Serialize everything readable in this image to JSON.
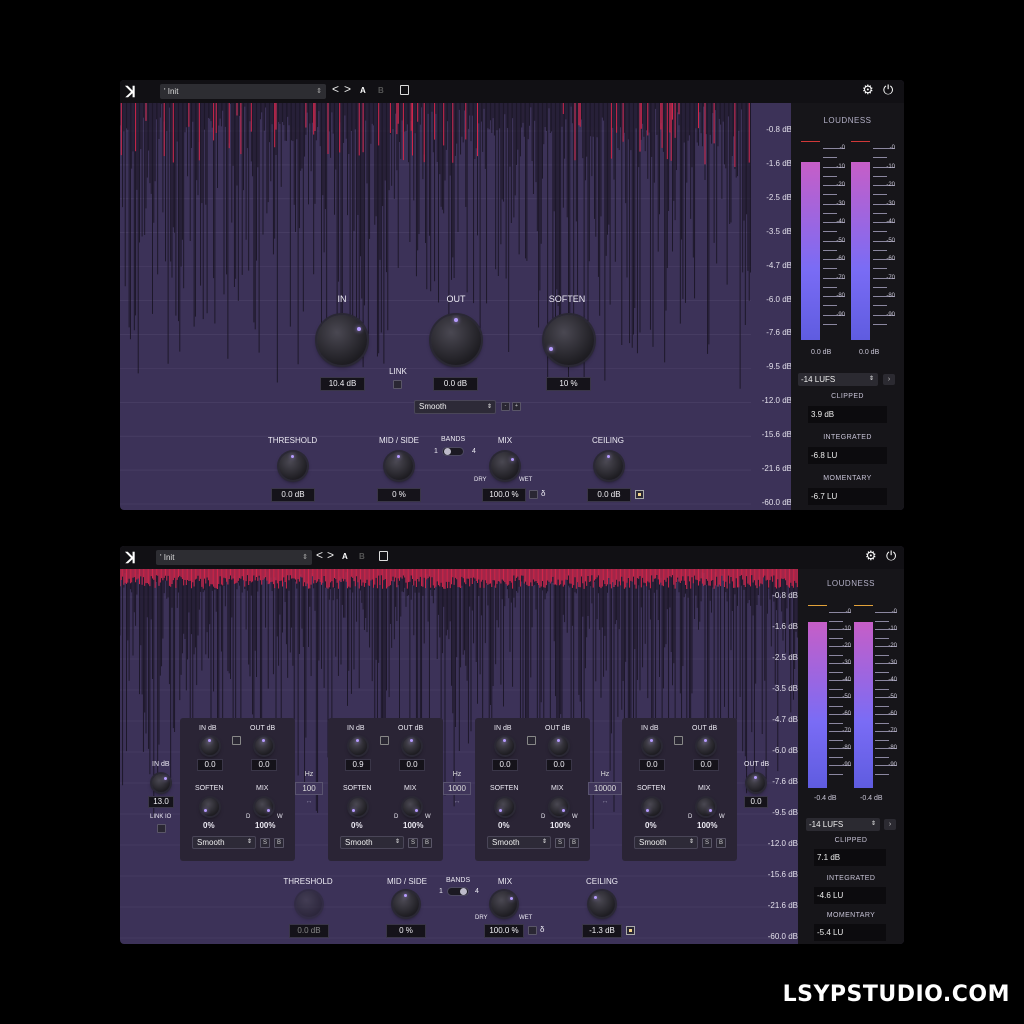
{
  "window": {
    "preset_name": "' Init",
    "nav_prev": "<",
    "nav_next": ">",
    "a_label": "A",
    "b_label": "B"
  },
  "db_scale": [
    "-0.8 dB",
    "-1.6 dB",
    "-2.5 dB",
    "-3.5 dB",
    "-4.7 dB",
    "-6.0 dB",
    "-7.6 dB",
    "-9.5 dB",
    "-12.0 dB",
    "-15.6 dB",
    "-21.6 dB",
    "-60.0 dB"
  ],
  "meter_scale": [
    "-0",
    "-10",
    "-20",
    "-30",
    "-40",
    "-50",
    "-60",
    "-70",
    "-80",
    "-90"
  ],
  "loudness": {
    "title": "LOUDNESS",
    "target": "-14 LUFS",
    "clipped_label": "CLIPPED",
    "integrated_label": "INTEGRATED",
    "momentary_label": "MOMENTARY"
  },
  "top": {
    "knobs": {
      "in_label": "IN",
      "out_label": "OUT",
      "soften_label": "SOFTEN",
      "in_value": "10.4 dB",
      "out_value": "0.0 dB",
      "soften_value": "10 %"
    },
    "link_label": "LINK",
    "mode": "Smooth",
    "threshold_label": "THRESHOLD",
    "threshold_value": "0.0 dB",
    "midside_label": "MID / SIDE",
    "midside_value": "0 %",
    "bands_label": "BANDS",
    "bands_min": "1",
    "bands_max": "4",
    "mix_label": "MIX",
    "mix_dry": "DRY",
    "mix_wet": "WET",
    "mix_value": "100.0 %",
    "delta": "δ",
    "ceiling_label": "CEILING",
    "ceiling_value": "0.0 dB",
    "meter_left": "0.0 dB",
    "meter_right": "0.0 dB",
    "clipped": "3.9 dB",
    "integrated": "-6.8 LU",
    "momentary": "-6.7 LU"
  },
  "bottom": {
    "in_db_label": "IN dB",
    "in_db_value": "13.0",
    "link_io": "LINK IO",
    "out_db_label": "OUT dB",
    "out_db_value": "0.0",
    "hz_label": "Hz",
    "crossovers": [
      "100",
      "1000",
      "10000"
    ],
    "bands": [
      {
        "in_label": "IN dB",
        "out_label": "OUT dB",
        "in": "0.0",
        "out": "0.0",
        "soften_label": "SOFTEN",
        "mix_label": "MIX",
        "soften": "0%",
        "mix": "100%",
        "mode": "Smooth",
        "s": "S",
        "b": "B",
        "d": "D",
        "w": "W"
      },
      {
        "in_label": "IN dB",
        "out_label": "OUT dB",
        "in": "0.9",
        "out": "0.0",
        "soften_label": "SOFTEN",
        "mix_label": "MIX",
        "soften": "0%",
        "mix": "100%",
        "mode": "Smooth",
        "s": "S",
        "b": "B",
        "d": "D",
        "w": "W"
      },
      {
        "in_label": "IN dB",
        "out_label": "OUT dB",
        "in": "0.0",
        "out": "0.0",
        "soften_label": "SOFTEN",
        "mix_label": "MIX",
        "soften": "0%",
        "mix": "100%",
        "mode": "Smooth",
        "s": "S",
        "b": "B",
        "d": "D",
        "w": "W"
      },
      {
        "in_label": "IN dB",
        "out_label": "OUT dB",
        "in": "0.0",
        "out": "0.0",
        "soften_label": "SOFTEN",
        "mix_label": "MIX",
        "soften": "0%",
        "mix": "100%",
        "mode": "Smooth",
        "s": "S",
        "b": "B",
        "d": "D",
        "w": "W"
      }
    ],
    "threshold_label": "THRESHOLD",
    "threshold_value": "0.0 dB",
    "midside_label": "MID / SIDE",
    "midside_value": "0 %",
    "bands_label": "BANDS",
    "bands_min": "1",
    "bands_max": "4",
    "mix_label": "MIX",
    "mix_dry": "DRY",
    "mix_wet": "WET",
    "mix_value": "100.0 %",
    "delta": "δ",
    "ceiling_label": "CEILING",
    "ceiling_value": "-1.3 dB",
    "meter_left": "-0.4 dB",
    "meter_right": "-0.4 dB",
    "clipped": "7.1 dB",
    "integrated": "-4.6 LU",
    "momentary": "-5.4 LU"
  },
  "watermark": "LSYPSTUDIO.COM",
  "colors": {
    "panel": "#3c3258",
    "clip": "#d1264a",
    "accent": "#b69cff"
  }
}
